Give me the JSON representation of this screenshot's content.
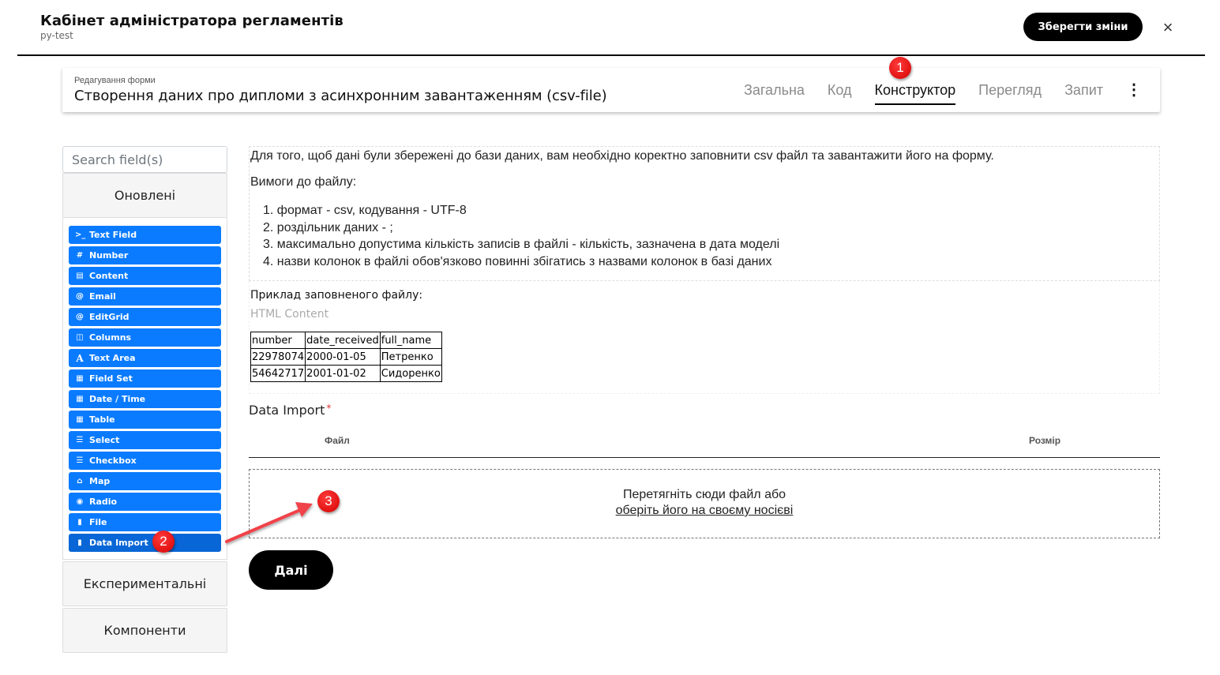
{
  "header": {
    "title": "Кабінет адміністратора регламентів",
    "subtitle": "py-test",
    "save_label": "Зберегти зміни",
    "close_icon": "×"
  },
  "form_card": {
    "label": "Редагування форми",
    "title": "Створення даних про дипломи з асинхронним завантаженням (csv-file)",
    "tabs": [
      {
        "label": "Загальна",
        "active": false
      },
      {
        "label": "Код",
        "active": false
      },
      {
        "label": "Конструктор",
        "active": true
      },
      {
        "label": "Перегляд",
        "active": false
      },
      {
        "label": "Запит",
        "active": false
      }
    ],
    "more_icon": "⋮"
  },
  "annotations": {
    "badge1": "1",
    "badge2": "2",
    "badge3": "3",
    "arrow_color": "#f0424a"
  },
  "sidebar": {
    "search_placeholder": "Search field(s)",
    "groups": [
      {
        "label": "Оновлені",
        "open": true
      },
      {
        "label": "Експериментальні",
        "open": false
      },
      {
        "label": "Компоненти",
        "open": false
      }
    ],
    "components": [
      {
        "label": "Text Field",
        "icon": "terminal-icon",
        "glyph": ">_"
      },
      {
        "label": "Number",
        "icon": "hashtag-icon",
        "glyph": "#"
      },
      {
        "label": "Content",
        "icon": "html5-icon",
        "glyph": "▤"
      },
      {
        "label": "Email",
        "icon": "at-icon",
        "glyph": "@"
      },
      {
        "label": "EditGrid",
        "icon": "at-icon",
        "glyph": "@"
      },
      {
        "label": "Columns",
        "icon": "columns-icon",
        "glyph": "◫"
      },
      {
        "label": "Text Area",
        "icon": "font-icon",
        "glyph": "A"
      },
      {
        "label": "Field Set",
        "icon": "th-large-icon",
        "glyph": "▦"
      },
      {
        "label": "Date / Time",
        "icon": "calendar-icon",
        "glyph": "▦"
      },
      {
        "label": "Table",
        "icon": "table-icon",
        "glyph": "▦"
      },
      {
        "label": "Select",
        "icon": "list-icon",
        "glyph": "☰"
      },
      {
        "label": "Checkbox",
        "icon": "list-icon",
        "glyph": "☰"
      },
      {
        "label": "Map",
        "icon": "home-icon",
        "glyph": "⌂"
      },
      {
        "label": "Radio",
        "icon": "dot-circle-icon",
        "glyph": "◉"
      },
      {
        "label": "File",
        "icon": "file-icon",
        "glyph": "▮"
      },
      {
        "label": "Data Import",
        "icon": "file-icon",
        "glyph": "▮",
        "selected": true
      }
    ],
    "accent_color": "#0a7bff"
  },
  "main": {
    "intro": "Для того, щоб дані були збережені до бази даних, вам необхідно коректно заповнити csv файл та завантажити його на форму.",
    "requirements_title": "Вимоги до файлу:",
    "requirements": [
      "1. формат - csv, кодування - UTF-8",
      "2. роздільник даних - ;",
      "3. максимально допустима кількість записів в файлі - кількість, зазначена в дата моделі",
      "4. назви колонок в файлі обов'язково повинні збігатись з назвами колонок в базі даних"
    ],
    "example_label": "Приклад заповненого файлу:",
    "html_content_label": "HTML Content",
    "sample_table": {
      "headers": [
        "number",
        "date_received",
        "full_name"
      ],
      "rows": [
        [
          "22978074",
          "2000-01-05",
          "Петренко"
        ],
        [
          "54642717",
          "2001-01-02",
          "Сидоренко"
        ]
      ]
    },
    "import_label": "Data Import",
    "required_mark": "*",
    "file_columns": {
      "file": "Файл",
      "size": "Розмір"
    },
    "drop_text": "Перетягніть сюди файл або",
    "drop_link": "оберіть його на своєму носієві",
    "next_label": "Далі"
  }
}
